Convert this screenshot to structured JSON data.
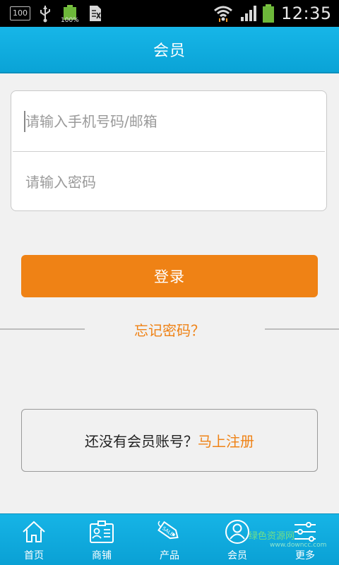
{
  "status_bar": {
    "box_label": "100",
    "battery_pct_small": "100%",
    "time": "12:35"
  },
  "header": {
    "title": "会员"
  },
  "login_form": {
    "phone_placeholder": "请输入手机号码/邮箱",
    "password_placeholder": "请输入密码",
    "submit_label": "登录"
  },
  "forgot_password": "忘记密码？",
  "register": {
    "prompt": "还没有会员账号？",
    "link_label": "马上注册"
  },
  "bottom_nav": {
    "items": [
      {
        "label": "首页",
        "icon": "home-icon"
      },
      {
        "label": "商铺",
        "icon": "shop-card-icon"
      },
      {
        "label": "产品",
        "icon": "sale-tag-icon"
      },
      {
        "label": "会员",
        "icon": "member-icon"
      },
      {
        "label": "更多",
        "icon": "settings-sliders-icon"
      }
    ]
  },
  "watermark": {
    "text": "绿色资源网",
    "sub": "www.downcc.com"
  },
  "colors": {
    "accent": "#ef8215",
    "header_blue": "#12aee2",
    "background": "#f1f1f1"
  }
}
